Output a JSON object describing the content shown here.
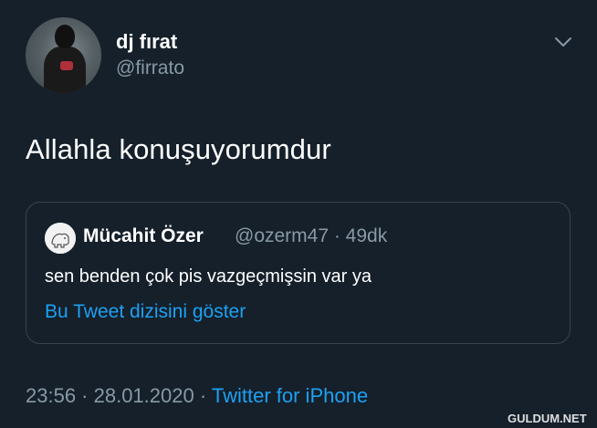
{
  "tweet": {
    "author": {
      "display_name": "dj fırat",
      "handle": "@firrato"
    },
    "text": "Allahla konuşuyorumdur",
    "menu_icon": "chevron-down-icon",
    "quoted": {
      "display_name": "Mücahit Özer",
      "handle_time": "@ozerm47 · 49dk",
      "text": "sen benden çok pis vazgeçmişsin var ya",
      "show_thread_label": "Bu Tweet dizisini göster"
    },
    "meta": {
      "timestamp": "23:56 · 28.01.2020 ·",
      "source": "Twitter for iPhone"
    }
  },
  "watermark": "GULDUM.NET",
  "colors": {
    "background": "#15202b",
    "text": "#ffffff",
    "secondary": "#8899a6",
    "link": "#1da1f2",
    "border": "#38444d"
  }
}
